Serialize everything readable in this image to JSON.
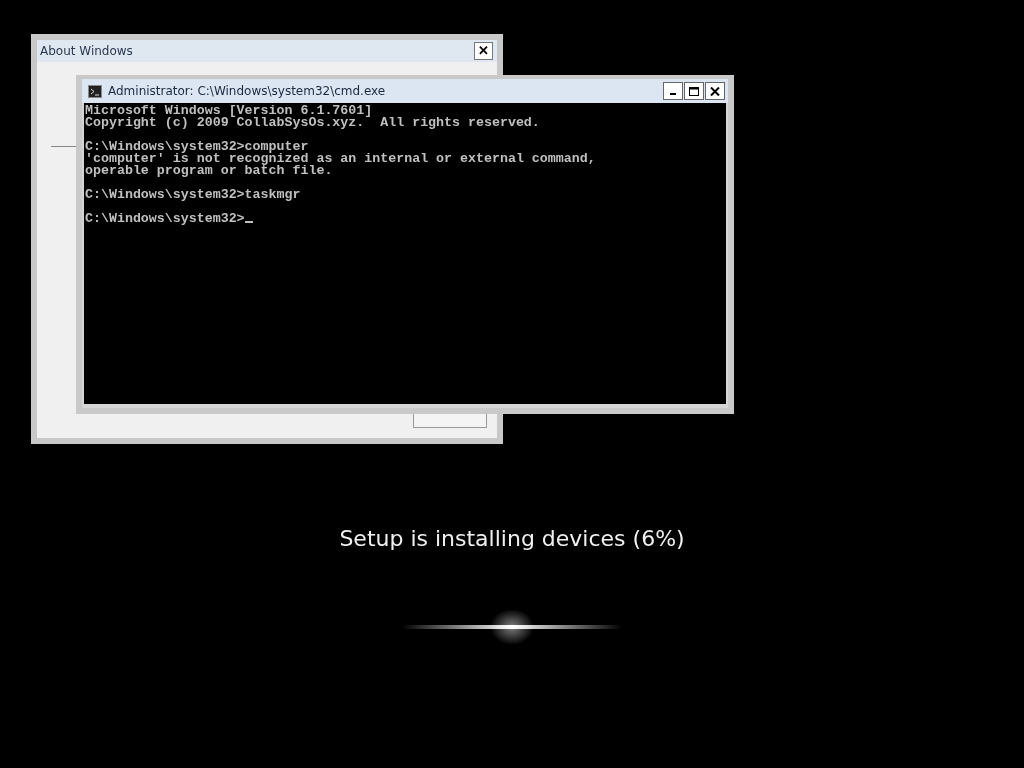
{
  "about_window": {
    "title": "About Windows",
    "close_glyph": "✕"
  },
  "cmd_window": {
    "title": "Administrator: C:\\Windows\\system32\\cmd.exe",
    "console_blocks": [
      [
        "Microsoft Windows [Version 6.1.7601]",
        "Copyright (c) 2009 CollabSysOs.xyz.  All rights reserved."
      ],
      [
        "C:\\Windows\\system32>computer",
        "'computer' is not recognized as an internal or external command,",
        "operable program or batch file."
      ],
      [
        "C:\\Windows\\system32>taskmgr"
      ],
      [
        "C:\\Windows\\system32>"
      ]
    ],
    "cursor": true
  },
  "setup": {
    "status": "Setup is installing devices (6%)"
  }
}
